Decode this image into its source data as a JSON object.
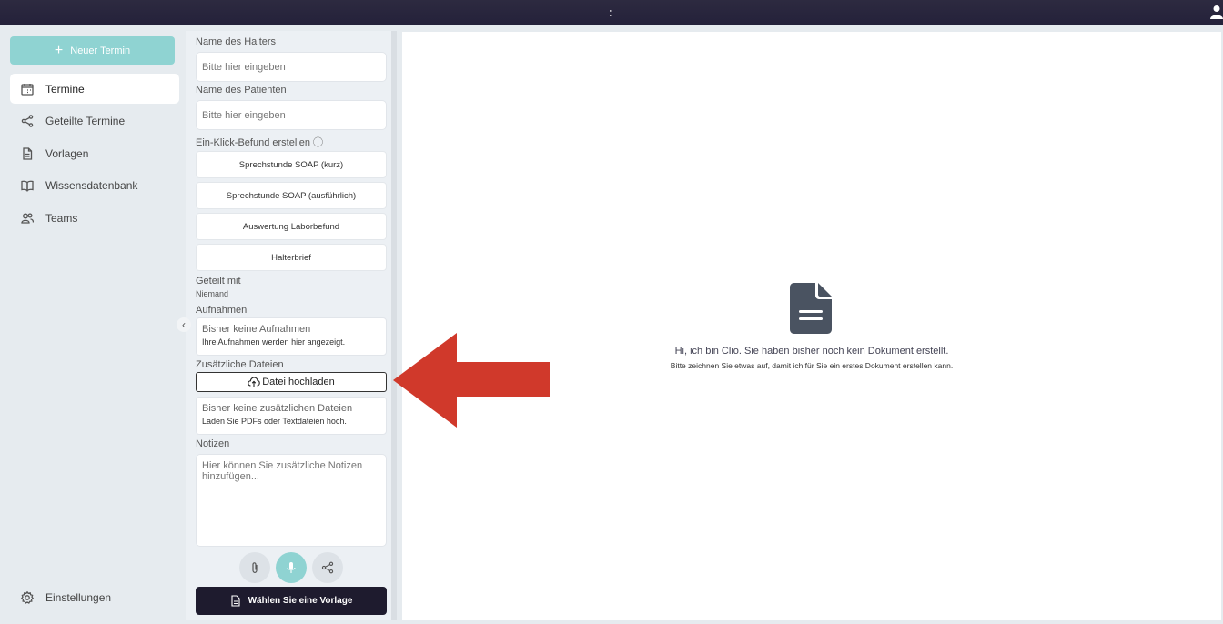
{
  "topbar": {
    "menu_glyph": ":"
  },
  "sidebar": {
    "new_button_label": "Neuer Termin",
    "items": [
      {
        "label": "Termine",
        "icon": "calendar-icon",
        "active": true
      },
      {
        "label": "Geteilte Termine",
        "icon": "share-icon",
        "active": false
      },
      {
        "label": "Vorlagen",
        "icon": "document-icon",
        "active": false
      },
      {
        "label": "Wissensdatenbank",
        "icon": "book-icon",
        "active": false
      },
      {
        "label": "Teams",
        "icon": "users-icon",
        "active": false
      }
    ],
    "settings_label": "Einstellungen"
  },
  "form": {
    "owner_label": "Name des Halters",
    "owner_placeholder": "Bitte hier eingeben",
    "patient_label": "Name des Patienten",
    "patient_placeholder": "Bitte hier eingeben",
    "oneclick_label": "Ein-Klick-Befund erstellen ⓘ",
    "templates": [
      "Sprechstunde SOAP (kurz)",
      "Sprechstunde SOAP (ausführlich)",
      "Auswertung Laborbefund",
      "Halterbrief"
    ],
    "shared_label": "Geteilt mit",
    "shared_value": "Niemand",
    "recordings_label": "Aufnahmen",
    "recordings_empty_title": "Bisher keine Aufnahmen",
    "recordings_empty_text": "Ihre Aufnahmen werden hier angezeigt.",
    "files_label": "Zusätzliche Dateien",
    "upload_label": "Datei hochladen",
    "files_empty_title": "Bisher keine zusätzlichen Dateien",
    "files_empty_text": "Laden Sie PDFs oder Textdateien hoch.",
    "notes_label": "Notizen",
    "notes_placeholder": "Hier können Sie zusätzliche Notizen hinzufügen...",
    "choose_template_label": "Wählen Sie eine Vorlage"
  },
  "main": {
    "empty_title": "Hi, ich bin Clio. Sie haben bisher noch kein Dokument erstellt.",
    "empty_subtitle": "Bitte zeichnen Sie etwas auf, damit ich für Sie ein erstes Dokument erstellen kann."
  },
  "colors": {
    "accent": "#8fd3d2",
    "dark": "#1e1b2e",
    "arrow": "#d0392b"
  }
}
